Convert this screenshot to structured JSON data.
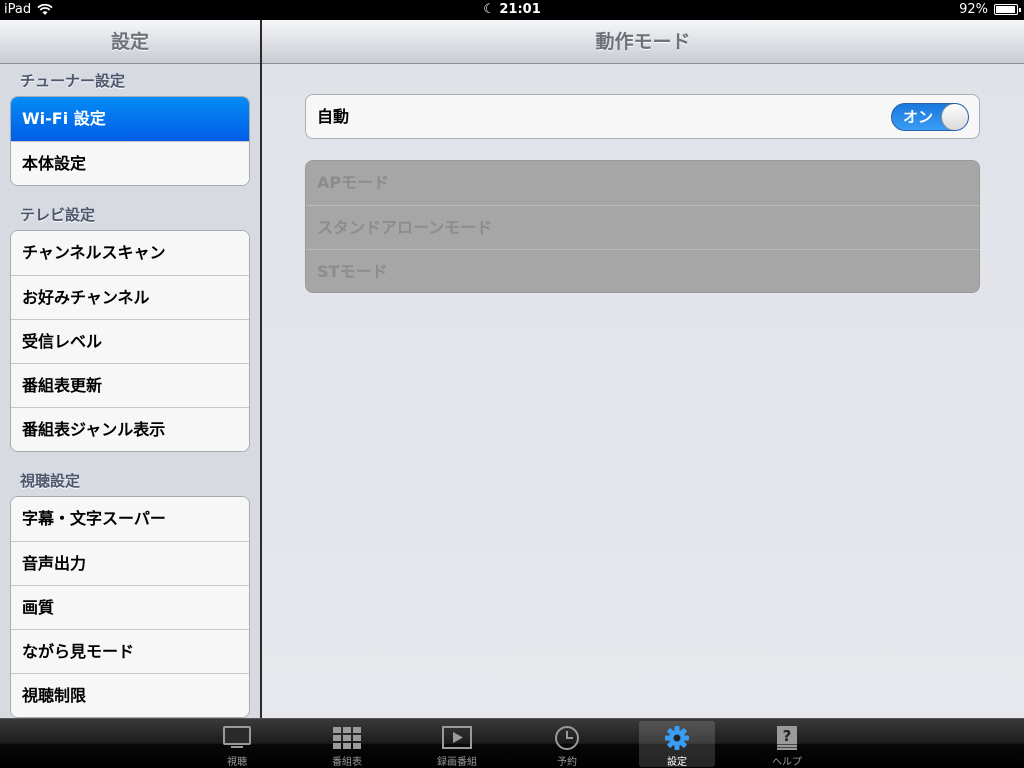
{
  "status_bar": {
    "device": "iPad",
    "time": "21:01",
    "battery": "92%"
  },
  "master": {
    "title": "設定",
    "sections": [
      {
        "header": "チューナー設定",
        "items": [
          "Wi-Fi 設定",
          "本体設定"
        ]
      },
      {
        "header": "テレビ設定",
        "items": [
          "チャンネルスキャン",
          "お好みチャンネル",
          "受信レベル",
          "番組表更新",
          "番組表ジャンル表示"
        ]
      },
      {
        "header": "視聴設定",
        "items": [
          "字幕・文字スーパー",
          "音声出力",
          "画質",
          "ながら見モード",
          "視聴制限"
        ]
      }
    ]
  },
  "detail": {
    "title": "動作モード",
    "auto": {
      "label": "自動",
      "toggle_text": "オン"
    },
    "modes": [
      "APモード",
      "スタンドアローンモード",
      "STモード"
    ]
  },
  "tabbar": {
    "tabs": [
      {
        "label": "視聴",
        "icon": "tv-icon"
      },
      {
        "label": "番組表",
        "icon": "grid-icon"
      },
      {
        "label": "録画番組",
        "icon": "play-icon"
      },
      {
        "label": "予約",
        "icon": "clock-icon"
      },
      {
        "label": "設定",
        "icon": "gear-icon"
      },
      {
        "label": "ヘルプ",
        "icon": "help-icon"
      }
    ]
  },
  "colors": {
    "selected_blue": "#015de6",
    "toggle_blue": "#1a78de"
  }
}
